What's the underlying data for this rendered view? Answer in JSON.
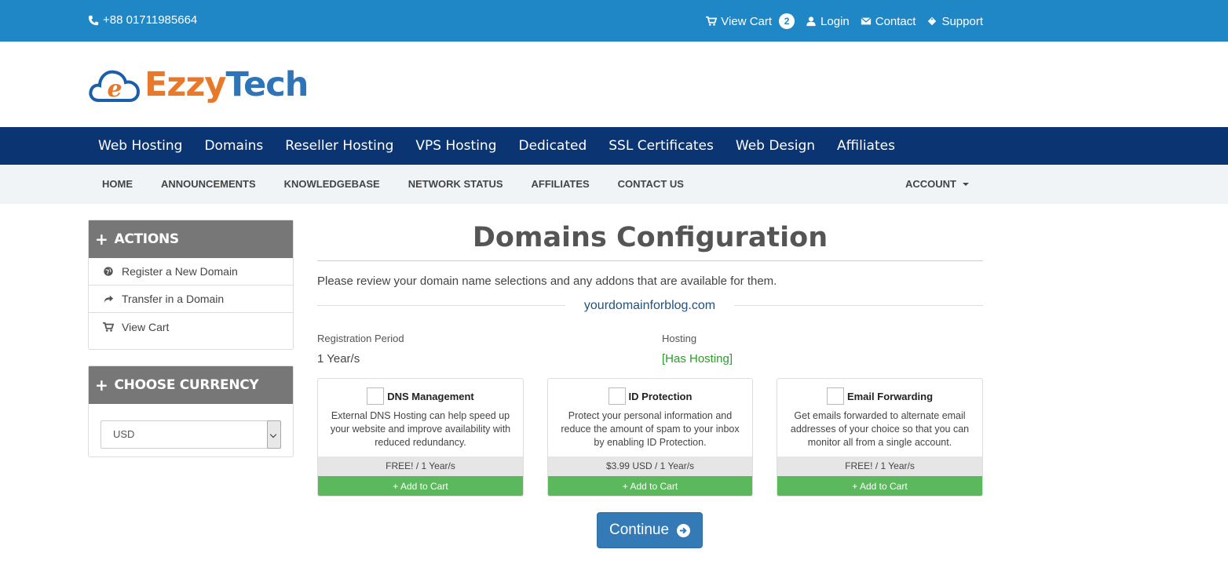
{
  "topbar": {
    "phone": "+88 01711985664",
    "view_cart": "View Cart",
    "cart_count": "2",
    "login": "Login",
    "contact": "Contact",
    "support": "Support"
  },
  "brand": {
    "part1": "Ezzy",
    "part2": "Tech",
    "icon_letter": "e",
    "colors": {
      "orange": "#e8782a",
      "blue": "#2e74b8"
    }
  },
  "mainnav": [
    "Web Hosting",
    "Domains",
    "Reseller Hosting",
    "VPS Hosting",
    "Dedicated",
    "SSL Certificates",
    "Web Design",
    "Affiliates"
  ],
  "subnav": {
    "items": [
      "HOME",
      "ANNOUNCEMENTS",
      "KNOWLEDGEBASE",
      "NETWORK STATUS",
      "AFFILIATES",
      "CONTACT US"
    ],
    "account": "ACCOUNT"
  },
  "sidebar": {
    "actions_title": "ACTIONS",
    "actions": [
      {
        "label": "Register a New Domain",
        "icon": "globe-icon"
      },
      {
        "label": "Transfer in a Domain",
        "icon": "share-arrow-icon"
      },
      {
        "label": "View Cart",
        "icon": "cart-icon"
      }
    ],
    "currency_title": "CHOOSE CURRENCY",
    "currency_selected": "USD"
  },
  "main": {
    "title": "Domains Configuration",
    "intro": "Please review your domain name selections and any addons that are available for them.",
    "domain": "yourdomainforblog.com",
    "registration_label": "Registration Period",
    "registration_value": "1 Year/s",
    "hosting_label": "Hosting",
    "hosting_value": "[Has Hosting]",
    "addons": [
      {
        "name": "DNS Management",
        "desc": "External DNS Hosting can help speed up your website and improve availability with reduced redundancy.",
        "price": "FREE! / 1 Year/s",
        "button": "Add to Cart"
      },
      {
        "name": "ID Protection",
        "desc": "Protect your personal information and reduce the amount of spam to your inbox by enabling ID Protection.",
        "price": "$3.99 USD / 1 Year/s",
        "button": "Add to Cart"
      },
      {
        "name": "Email Forwarding",
        "desc": "Get emails forwarded to alternate email addresses of your choice so that you can monitor all from a single account.",
        "price": "FREE! / 1 Year/s",
        "button": "Add to Cart"
      }
    ],
    "continue": "Continue"
  }
}
